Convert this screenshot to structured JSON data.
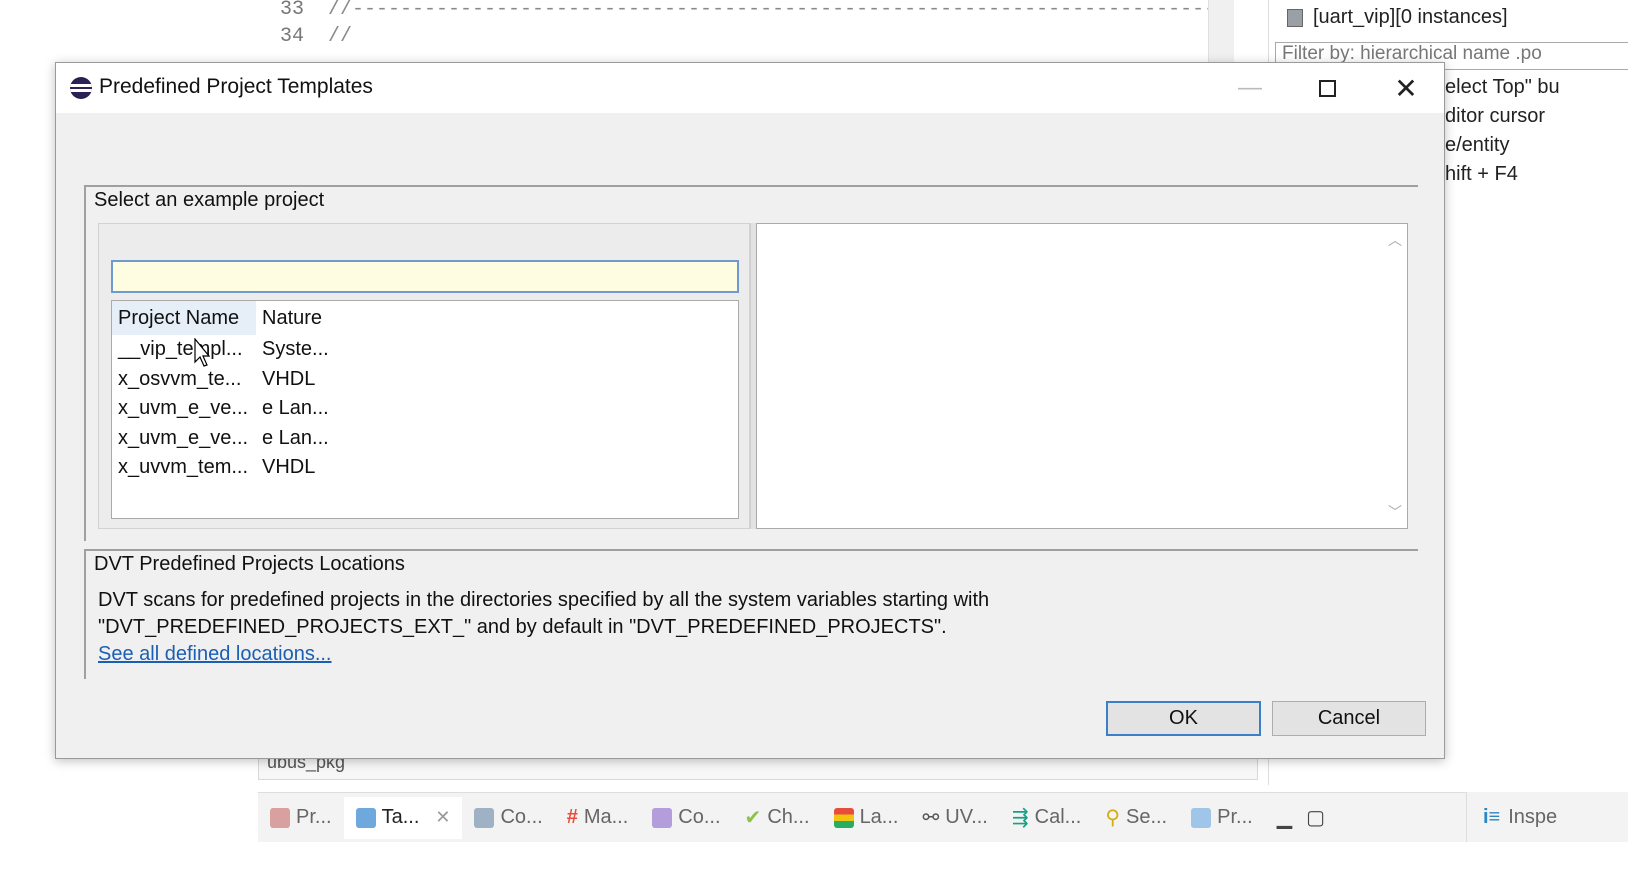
{
  "editor": {
    "lines": [
      {
        "num": "33",
        "code": "//---------------------------------------------------------------------------"
      },
      {
        "num": "34",
        "code": "//"
      }
    ],
    "breadcrumb": "ubus_pkg"
  },
  "right_panel": {
    "title": "[uart_vip][0 instances]",
    "filter_placeholder": "Filter by: hierarchical name .po",
    "help_lines": [
      "elect Top\" bu",
      "ditor cursor",
      "e/entity",
      "hift + F4"
    ]
  },
  "bottom_tabs": [
    {
      "label": "Pr...",
      "color": "#c0392b"
    },
    {
      "label": "Ta...",
      "color": "#2e86c1",
      "active": true
    },
    {
      "label": "Co...",
      "color": "#5d6d7e"
    },
    {
      "label": "Ma...",
      "color": "#e74c3c",
      "glyph": "#"
    },
    {
      "label": "Co...",
      "color": "#7d3c98"
    },
    {
      "label": "Ch...",
      "color": "#27ae60"
    },
    {
      "label": "La...",
      "color": "#e67e22"
    },
    {
      "label": "UV...",
      "color": "#34495e"
    },
    {
      "label": "Cal...",
      "color": "#16a085"
    },
    {
      "label": "Se...",
      "color": "#d4ac0d"
    },
    {
      "label": "Pr...",
      "color": "#2e86c1"
    }
  ],
  "inspect_tab": {
    "label": "Inspe"
  },
  "dialog": {
    "title": "Predefined Project Templates",
    "group1_label": "Select an example project",
    "search_value": "",
    "columns": [
      "Project Name",
      "Nature"
    ],
    "rows": [
      {
        "name": "__vip_templ...",
        "nature": "Syste..."
      },
      {
        "name": "x_osvvm_te...",
        "nature": "VHDL"
      },
      {
        "name": "x_uvm_e_ve...",
        "nature": "e Lan..."
      },
      {
        "name": "x_uvm_e_ve...",
        "nature": "e Lan..."
      },
      {
        "name": "x_uvvm_tem...",
        "nature": "VHDL"
      }
    ],
    "group2_label": "DVT Predefined Projects Locations",
    "description_line1": "DVT scans for predefined projects in the directories specified by all the system variables starting with",
    "description_line2": "\"DVT_PREDEFINED_PROJECTS_EXT_\" and by default in \"DVT_PREDEFINED_PROJECTS\".",
    "link": "See all defined locations...",
    "ok_label": "OK",
    "cancel_label": "Cancel"
  }
}
